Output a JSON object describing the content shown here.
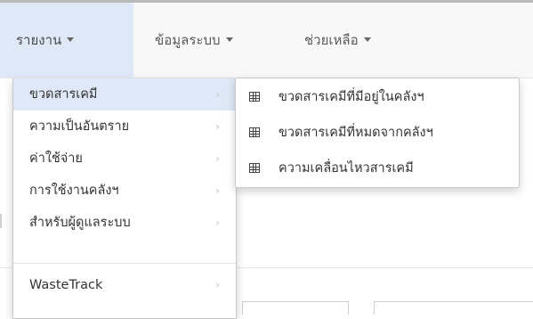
{
  "navbar": {
    "items": [
      {
        "label": "รายงาน",
        "active": true
      },
      {
        "label": "ข้อมูลระบบ",
        "active": false
      },
      {
        "label": "ช่วยเหลือ",
        "active": false
      }
    ]
  },
  "dropdown": {
    "items": [
      {
        "label": "ขวดสารเคมี",
        "active": true
      },
      {
        "label": "ความเป็นอันตราย",
        "active": false
      },
      {
        "label": "ค่าใช้จ่าย",
        "active": false
      },
      {
        "label": "การใช้งานคลังฯ",
        "active": false
      },
      {
        "label": "สำหรับผู้ดูแลระบบ",
        "active": false
      },
      {
        "label": "WasteTrack",
        "active": false
      }
    ],
    "arrow_glyph": "›"
  },
  "submenu": {
    "items": [
      {
        "label": "ขวดสารเคมีที่มีอยู่ในคลังฯ",
        "icon": "table-icon"
      },
      {
        "label": "ขวดสารเคมีที่หมดจากคลังฯ",
        "icon": "table-icon"
      },
      {
        "label": "ความเคลื่อนไหวสารเคมี",
        "icon": "table-icon"
      }
    ]
  },
  "colors": {
    "navbar_bg": "#f8f8f8",
    "active_bg": "#dfe8f6",
    "text": "#333333",
    "arrow": "#c4c4c4"
  }
}
